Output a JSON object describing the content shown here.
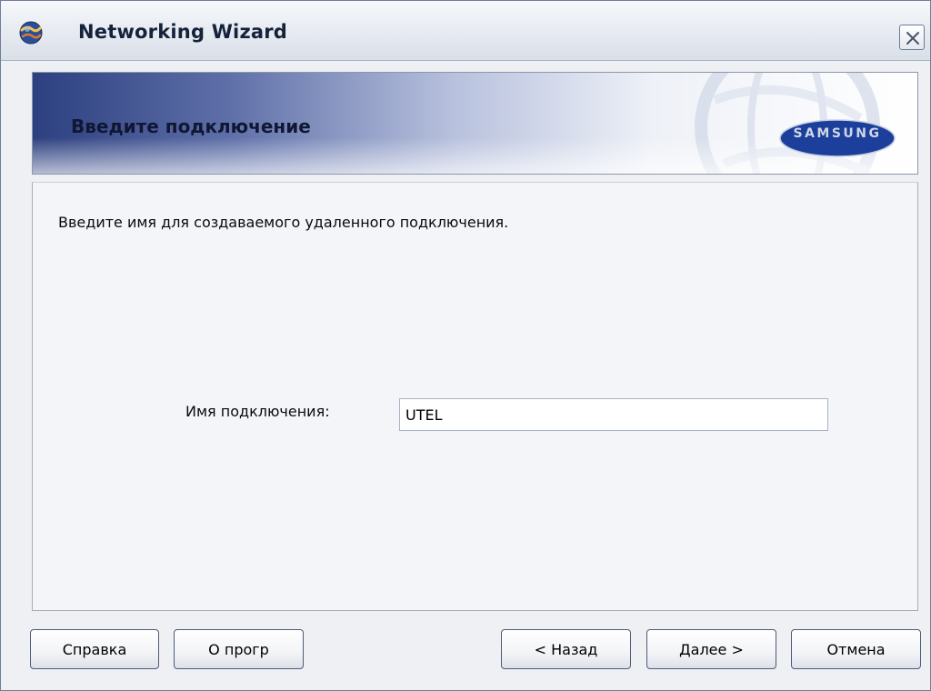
{
  "window": {
    "title": "Networking Wizard",
    "icon": "globe-app-icon",
    "close_icon": "close-icon"
  },
  "banner": {
    "title": "Введите подключение",
    "brand": "SAMSUNG",
    "colors": {
      "dark": "#2c3f7f",
      "light": "#ffffff"
    }
  },
  "content": {
    "instruction": "Введите имя для создаваемого удаленного подключения.",
    "connection_name_label": "Имя подключения:",
    "connection_name_value": "UTEL"
  },
  "buttons": {
    "help": "Справка",
    "about": "О прогр",
    "back": "< Назад",
    "next": "Далее >",
    "cancel": "Отмена"
  }
}
